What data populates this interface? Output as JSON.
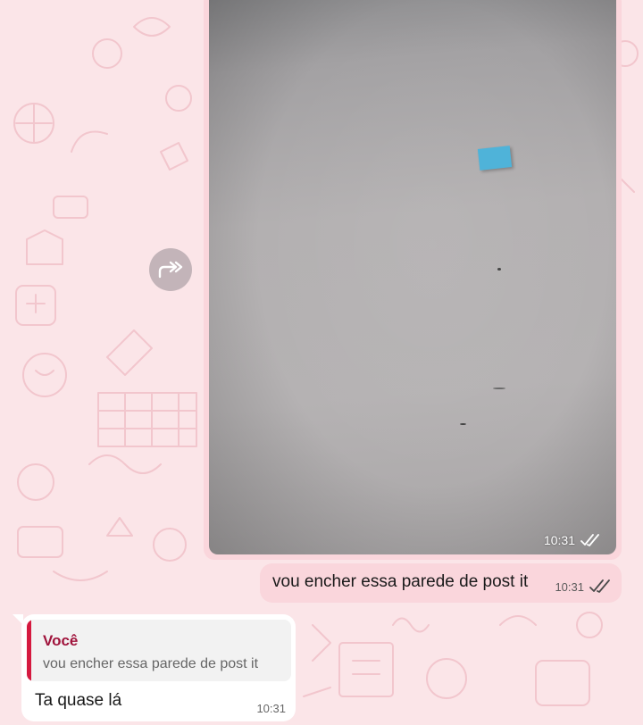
{
  "theme": {
    "chat_background": "#fbe5e8",
    "outgoing_bubble": "#fad6dc",
    "incoming_bubble": "#ffffff",
    "quote_accent": "#d5193f"
  },
  "messages": [
    {
      "type": "image",
      "direction": "outgoing",
      "time": "10:31",
      "status_icon": "double-check-icon",
      "forward_icon": "forward-icon"
    },
    {
      "type": "text",
      "direction": "outgoing",
      "text": "vou encher essa parede de post it",
      "time": "10:31",
      "status_icon": "double-check-icon"
    },
    {
      "type": "text",
      "direction": "incoming",
      "quoted": {
        "author": "Você",
        "text": "vou encher essa parede de post it"
      },
      "text": "Ta quase lá",
      "time": "10:31"
    }
  ]
}
